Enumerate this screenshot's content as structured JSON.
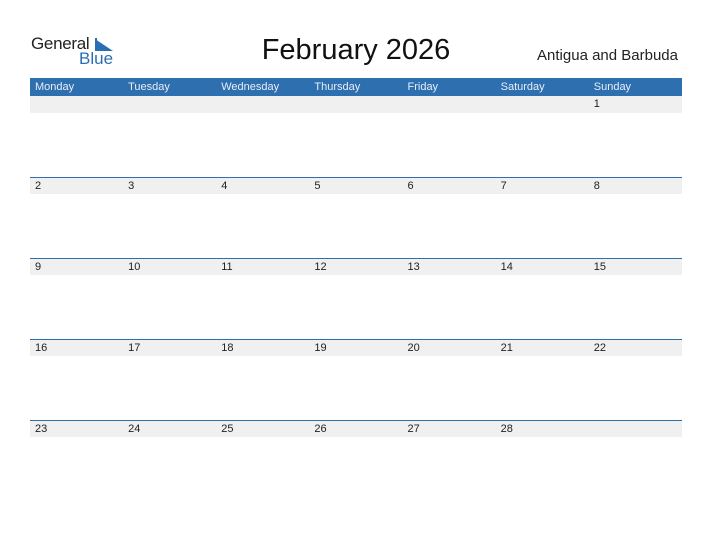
{
  "logo": {
    "word1": "General",
    "word2": "Blue"
  },
  "title": "February 2026",
  "country": "Antigua and Barbuda",
  "weekdays": [
    "Monday",
    "Tuesday",
    "Wednesday",
    "Thursday",
    "Friday",
    "Saturday",
    "Sunday"
  ],
  "weeks": [
    [
      "",
      "",
      "",
      "",
      "",
      "",
      "1"
    ],
    [
      "2",
      "3",
      "4",
      "5",
      "6",
      "7",
      "8"
    ],
    [
      "9",
      "10",
      "11",
      "12",
      "13",
      "14",
      "15"
    ],
    [
      "16",
      "17",
      "18",
      "19",
      "20",
      "21",
      "22"
    ],
    [
      "23",
      "24",
      "25",
      "26",
      "27",
      "28",
      ""
    ]
  ],
  "colors": {
    "accent": "#2e6fb0",
    "band": "#f0f0f0"
  }
}
